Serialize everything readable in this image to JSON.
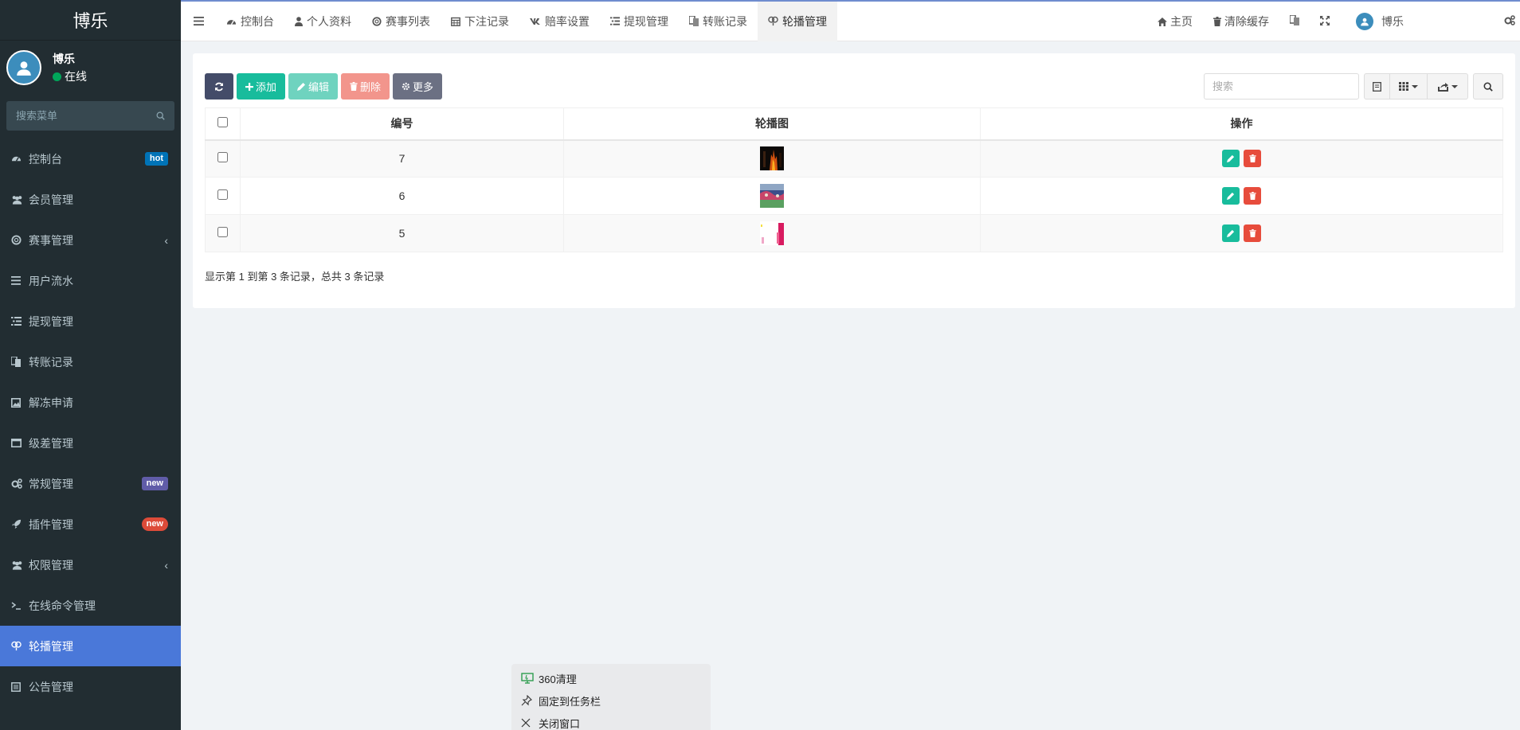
{
  "sidebar": {
    "logo": "博乐",
    "user": {
      "name": "博乐",
      "status": "在线"
    },
    "search_placeholder": "搜索菜单",
    "items": [
      {
        "label": "控制台",
        "icon": "dashboard-icon",
        "badge": "hot"
      },
      {
        "label": "会员管理",
        "icon": "users-icon"
      },
      {
        "label": "赛事管理",
        "icon": "life-ring-icon"
      },
      {
        "label": "用户流水",
        "icon": "list-icon"
      },
      {
        "label": "提现管理",
        "icon": "list-alt-icon"
      },
      {
        "label": "转账记录",
        "icon": "transfer-icon"
      },
      {
        "label": "解冻申请",
        "icon": "picture-icon"
      },
      {
        "label": "级差管理",
        "icon": "window-icon"
      },
      {
        "label": "常规管理",
        "icon": "cogs-icon",
        "badge": "new"
      },
      {
        "label": "插件管理",
        "icon": "rocket-icon",
        "badge": "new"
      },
      {
        "label": "权限管理",
        "icon": "group-icon"
      },
      {
        "label": "在线命令管理",
        "icon": "terminal-icon"
      },
      {
        "label": "轮播管理",
        "icon": "slides-icon"
      },
      {
        "label": "公告管理",
        "icon": "notice-icon"
      }
    ]
  },
  "topbar": {
    "tabs": [
      {
        "label": "控制台",
        "icon": "dashboard-icon"
      },
      {
        "label": "个人资料",
        "icon": "user-icon"
      },
      {
        "label": "赛事列表",
        "icon": "life-ring-icon"
      },
      {
        "label": "下注记录",
        "icon": "calendar-icon"
      },
      {
        "label": "赔率设置",
        "icon": "vk-icon"
      },
      {
        "label": "提现管理",
        "icon": "list-alt-icon"
      },
      {
        "label": "转账记录",
        "icon": "transfer-icon"
      },
      {
        "label": "轮播管理",
        "icon": "slides-icon"
      }
    ],
    "right": {
      "home": "主页",
      "clear_cache": "清除缓存",
      "username": "博乐"
    }
  },
  "toolbar": {
    "add": "添加",
    "edit": "编辑",
    "delete": "删除",
    "more": "更多",
    "search_placeholder": "搜索"
  },
  "table": {
    "headers": [
      "编号",
      "轮播图",
      "操作"
    ],
    "rows": [
      {
        "id": "7",
        "thumb": "dark-fire"
      },
      {
        "id": "6",
        "thumb": "stadium"
      },
      {
        "id": "5",
        "thumb": "pink"
      }
    ],
    "footer": "显示第 1 到第 3 条记录，总共 3 条记录"
  },
  "popup": {
    "items": [
      "360清理",
      "固定到任务栏",
      "关闭窗口"
    ]
  },
  "colors": {
    "sidebar_bg": "#222d32",
    "active_menu": "#4a78d9",
    "accent_green": "#18bc9c",
    "danger": "#e74c3c"
  }
}
